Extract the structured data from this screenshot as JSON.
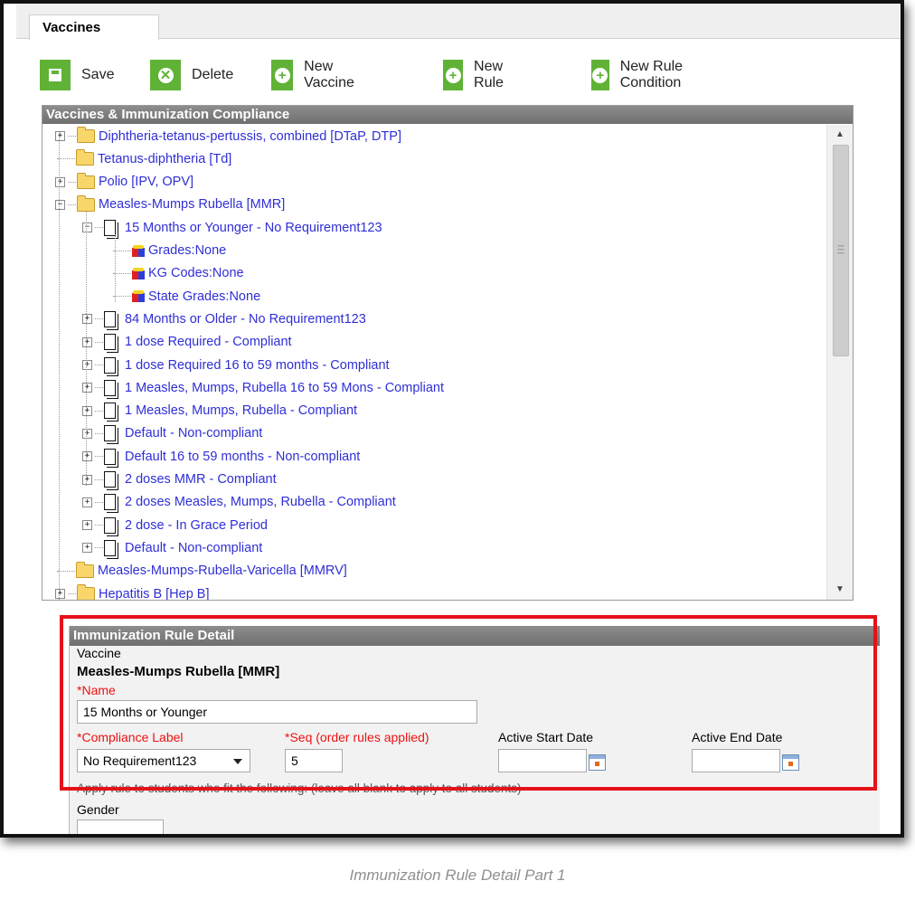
{
  "tab": {
    "label": "Vaccines"
  },
  "toolbar": {
    "save": "Save",
    "delete": "Delete",
    "new_vaccine": "New Vaccine",
    "new_rule": "New Rule",
    "new_rule_condition": "New Rule Condition"
  },
  "tree": {
    "header": "Vaccines & Immunization Compliance",
    "items": [
      {
        "label": "Diphtheria-tetanus-pertussis, combined [DTaP, DTP]",
        "type": "folder",
        "toggle": "+"
      },
      {
        "label": "Tetanus-diphtheria [Td]",
        "type": "folder",
        "toggle": ""
      },
      {
        "label": "Polio [IPV, OPV]",
        "type": "folder",
        "toggle": "+"
      },
      {
        "label": "Measles-Mumps Rubella [MMR]",
        "type": "folder",
        "toggle": "-"
      },
      {
        "label": "15 Months or Younger - No Requirement123",
        "type": "rule",
        "toggle": "-"
      },
      {
        "label": "Grades:None",
        "type": "condition",
        "toggle": ""
      },
      {
        "label": "KG Codes:None",
        "type": "condition",
        "toggle": ""
      },
      {
        "label": "State Grades:None",
        "type": "condition",
        "toggle": ""
      },
      {
        "label": "84 Months or Older - No Requirement123",
        "type": "rule",
        "toggle": "+"
      },
      {
        "label": "1 dose Required - Compliant",
        "type": "rule",
        "toggle": "+"
      },
      {
        "label": "1 dose Required 16 to 59 months - Compliant",
        "type": "rule",
        "toggle": "+"
      },
      {
        "label": "1 Measles, Mumps, Rubella 16 to 59 Mons - Compliant",
        "type": "rule",
        "toggle": "+"
      },
      {
        "label": "1 Measles, Mumps, Rubella - Compliant",
        "type": "rule",
        "toggle": "+"
      },
      {
        "label": "Default - Non-compliant",
        "type": "rule",
        "toggle": "+"
      },
      {
        "label": "Default 16 to 59 months - Non-compliant",
        "type": "rule",
        "toggle": "+"
      },
      {
        "label": "2 doses MMR - Compliant",
        "type": "rule",
        "toggle": "+"
      },
      {
        "label": "2 doses Measles, Mumps, Rubella - Compliant",
        "type": "rule",
        "toggle": "+"
      },
      {
        "label": "2 dose - In Grace Period",
        "type": "rule",
        "toggle": "+"
      },
      {
        "label": "Default - Non-compliant",
        "type": "rule",
        "toggle": "+"
      },
      {
        "label": "Measles-Mumps-Rubella-Varicella [MMRV]",
        "type": "folder",
        "toggle": ""
      },
      {
        "label": "Hepatitis B [Hep B]",
        "type": "folder",
        "toggle": "+"
      }
    ]
  },
  "detail": {
    "header": "Immunization Rule Detail",
    "vaccine_label": "Vaccine",
    "vaccine_value": "Measles-Mumps Rubella [MMR]",
    "name_label": "Name",
    "name_value": "15 Months or Younger",
    "compliance_label": "Compliance Label",
    "compliance_value": "No Requirement123",
    "seq_label": "Seq (order rules applied)",
    "seq_value": "5",
    "start_label": "Active Start Date",
    "start_value": "",
    "end_label": "Active End Date",
    "end_value": "",
    "apply_note": "Apply rule to students who fit the following: (leave all blank to apply to all students)",
    "gender_label": "Gender",
    "required_mark": "*"
  },
  "caption": "Immunization Rule Detail Part 1",
  "colors": {
    "toolbar_green": "#5fb236",
    "link_blue": "#2f2fd6",
    "required_red": "#e11111",
    "highlight_red": "#e5121a",
    "panel_header": "#7a7a7a"
  }
}
